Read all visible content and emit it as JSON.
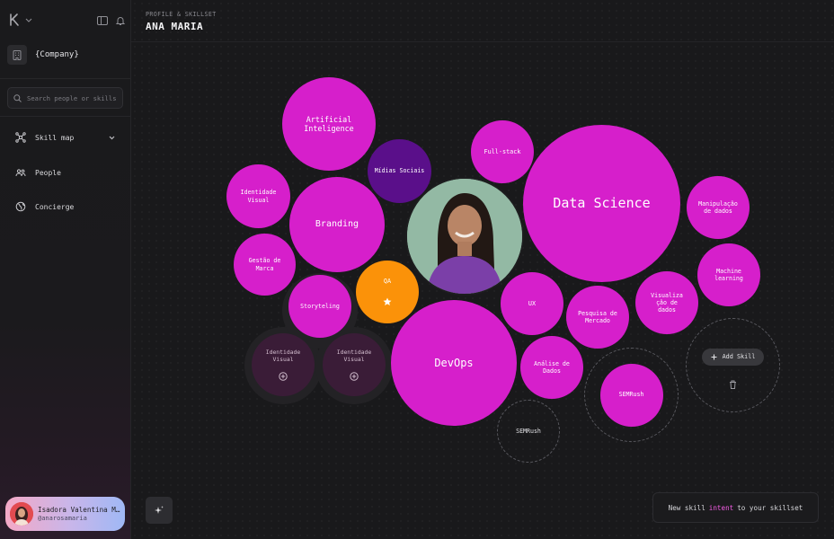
{
  "sidebar": {
    "company": "{Company}",
    "search_placeholder": "Search people or skills",
    "nav": [
      {
        "label": "Skill map",
        "icon": "network-icon"
      },
      {
        "label": "People",
        "icon": "people-icon"
      },
      {
        "label": "Concierge",
        "icon": "globe-icon"
      }
    ],
    "user": {
      "name": "Isadora Valentina Mon…",
      "handle": "@anarosamaria"
    }
  },
  "header": {
    "kicker": "PROFILE & SKILLSET",
    "title": "ANA MARIA"
  },
  "skills": {
    "artificial_inteligence": "Artificial\nInteligence",
    "midias_sociais": "Mídias Sociais",
    "full_stack": "Full-stack",
    "data_science": "Data Science",
    "identidade_visual": "Identidade\nVisual",
    "branding": "Branding",
    "manipulacao": "Manipulação\nde dados",
    "gestao_marca": "Gestão de\nMarca",
    "machine_learning": "Machine\nlearning",
    "storyteling": "Storyteling",
    "qa": "QA",
    "ux": "UX",
    "pesquisa": "Pesquisa de\nMercado",
    "visualizacao": "Visualiza\nção de\ndados",
    "suggest_1": "Identidade\nVisual",
    "suggest_2": "Identidade\nVisual",
    "devops": "DevOps",
    "analise": "Análise de\nDados",
    "semrush_1": "SEMRush",
    "semrush_2": "SEMRush",
    "add_skill": "Add Skill"
  },
  "toast": {
    "before": "New skill",
    "highlight": "intent",
    "after": "to your skillset"
  },
  "colors": {
    "skill": "#d61fcb",
    "social": "#5a0f8a",
    "qa": "#fb9209",
    "toast_highlight": "#f25ce3"
  }
}
